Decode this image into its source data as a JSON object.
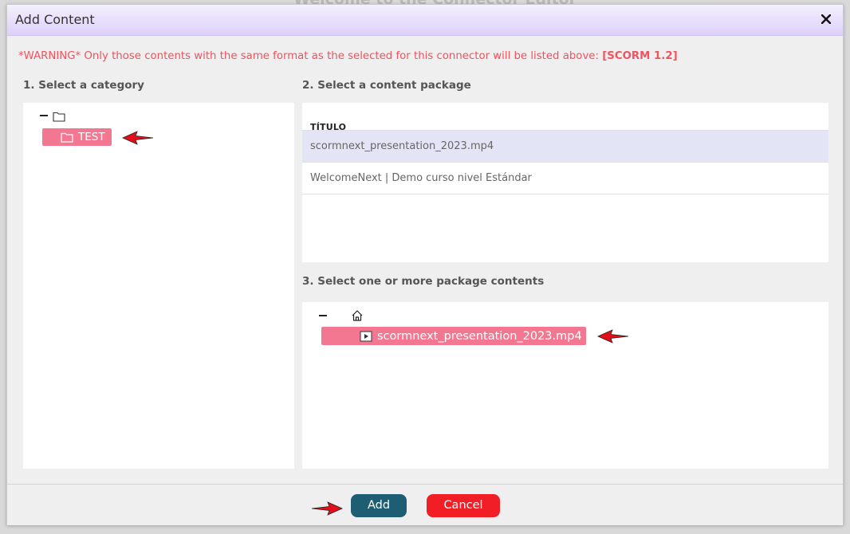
{
  "background": {
    "title": "Welcome to the Connector Editor"
  },
  "dialog": {
    "title": "Add Content",
    "close_label": "✕",
    "warning_prefix": "*WARNING* Only those contents with the same format as the selected for this connector will be listed above: ",
    "warning_format": "[SCORM 1.2]"
  },
  "sections": {
    "category_label": "1. Select a category",
    "package_label": "2. Select a content package",
    "contents_label": "3. Select one or more package contents"
  },
  "category_tree": {
    "root_icon": "folder-icon",
    "selected_node": "TEST"
  },
  "package_table": {
    "header": "TÍTULO",
    "rows": [
      "scormnext_presentation_2023.mp4",
      "WelcomeNext | Demo curso nivel Estándar"
    ]
  },
  "contents_tree": {
    "root_icon": "home-icon",
    "selected_node": "scormnext_presentation_2023.mp4"
  },
  "footer": {
    "add_label": "Add",
    "cancel_label": "Cancel"
  },
  "colors": {
    "accent_pink": "#f47792",
    "add_button": "#1d5e73",
    "cancel_button": "#f11f25",
    "warning": "#f0525e",
    "arrow": "#e3101a"
  }
}
